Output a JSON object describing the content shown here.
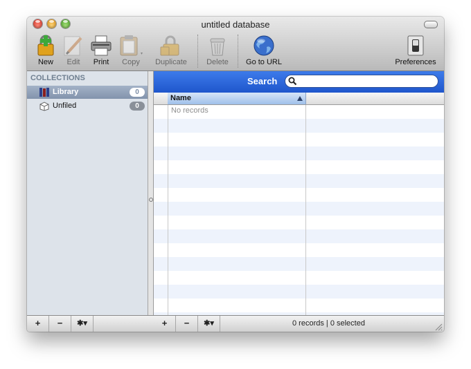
{
  "window": {
    "title": "untitled database"
  },
  "toolbar": {
    "new_label": "New",
    "edit_label": "Edit",
    "print_label": "Print",
    "copy_label": "Copy",
    "duplicate_label": "Duplicate",
    "delete_label": "Delete",
    "go_to_url_label": "Go to URL",
    "preferences_label": "Preferences"
  },
  "sidebar": {
    "header": "COLLECTIONS",
    "items": [
      {
        "label": "Library",
        "count": "0",
        "icon": "books-icon",
        "selected": true
      },
      {
        "label": "Unfiled",
        "count": "0",
        "icon": "box-icon",
        "selected": false
      }
    ]
  },
  "search": {
    "label": "Search",
    "value": "",
    "placeholder": ""
  },
  "table": {
    "columns": [
      {
        "label": "Name",
        "sorted": "ascending"
      }
    ],
    "empty_text": "No records"
  },
  "bottom": {
    "add_label": "+",
    "remove_label": "−",
    "action_label": "✱▾",
    "status": "0 records | 0 selected"
  },
  "colors": {
    "search_bar": "#2560d8",
    "selection": "#8a9bb4",
    "stripe": "#eef3fc"
  }
}
